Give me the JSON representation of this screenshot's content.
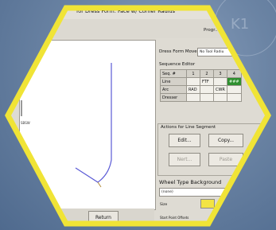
{
  "window": {
    "title": "for Dress Form:  Face w/ Corner Radius",
    "program_label": "Progr..."
  },
  "canvas": {
    "return_label": "Return",
    "side_label": "SBSW"
  },
  "dress_form_move": {
    "label": "Dress Form Move",
    "value": "No Tool Radiu"
  },
  "sequence_editor": {
    "title": "Sequence Editor",
    "header_label": "Seq. #",
    "columns": [
      "1",
      "2",
      "3",
      "4"
    ],
    "rows": [
      {
        "label": "Line",
        "cells": [
          "",
          "FTF",
          "",
          "###"
        ]
      },
      {
        "label": "Arc",
        "cells": [
          "RAD",
          "",
          "CWR",
          ""
        ]
      },
      {
        "label": "Dresser",
        "cells": [
          "",
          "",
          "",
          ""
        ]
      }
    ]
  },
  "actions": {
    "title": "Actions for Line Segment",
    "buttons": [
      "Edit...",
      "Copy...",
      "Nert...",
      "Paste"
    ]
  },
  "wheel": {
    "label": "Wheel Type Background",
    "value": "(none)",
    "size_label": "Size",
    "start_offsets_label": "Start Point Offsets"
  },
  "colors": {
    "frame": "#f0e436",
    "accent_green": "#2f8f2f",
    "background": "#5f7a9c"
  },
  "watermark": "K1"
}
